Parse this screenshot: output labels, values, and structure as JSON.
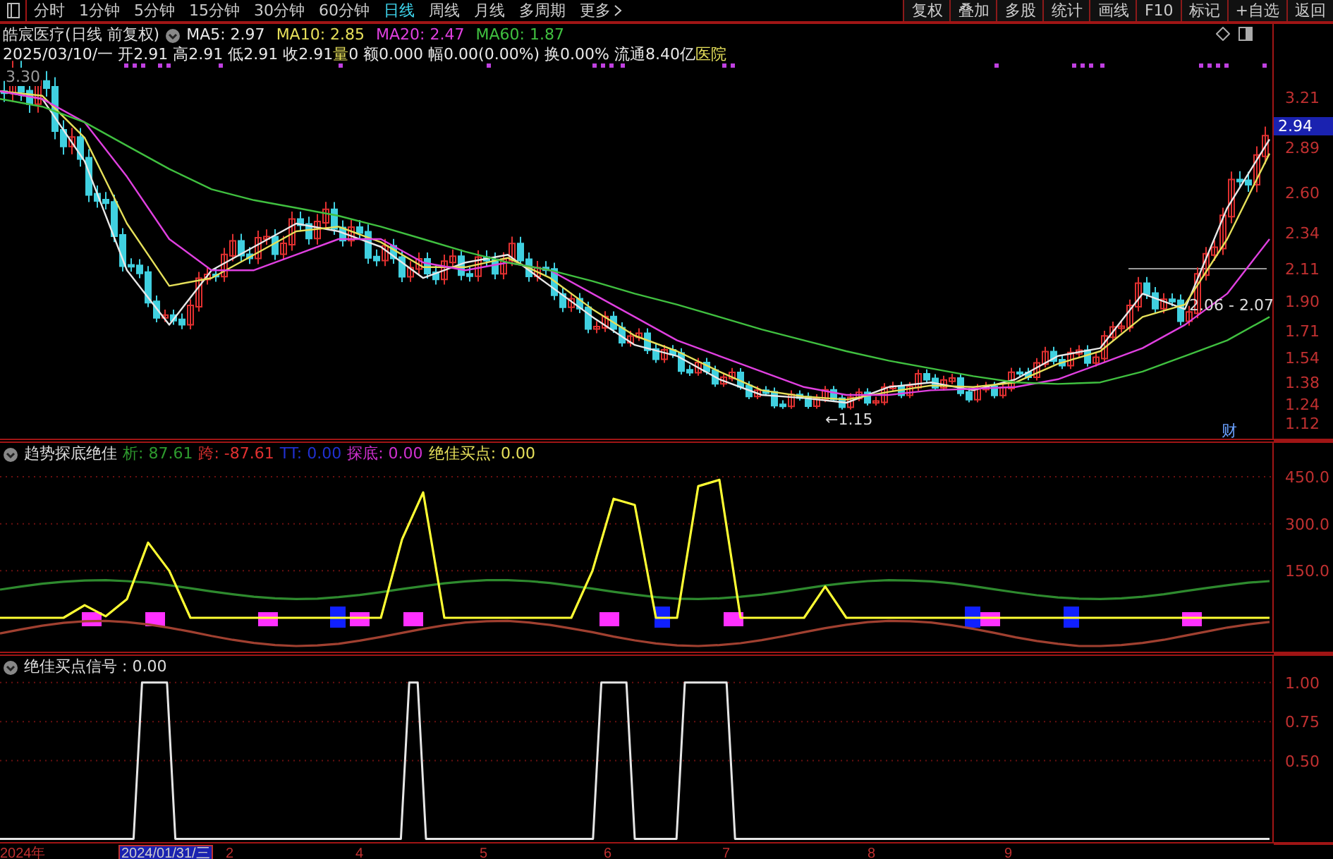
{
  "toolbar": {
    "periods": [
      {
        "label": "分时",
        "selected": false
      },
      {
        "label": "1分钟",
        "selected": false
      },
      {
        "label": "5分钟",
        "selected": false
      },
      {
        "label": "15分钟",
        "selected": false
      },
      {
        "label": "30分钟",
        "selected": false
      },
      {
        "label": "60分钟",
        "selected": false
      },
      {
        "label": "日线",
        "selected": true
      },
      {
        "label": "周线",
        "selected": false
      },
      {
        "label": "月线",
        "selected": false
      },
      {
        "label": "多周期",
        "selected": false
      },
      {
        "label": "更多",
        "selected": false
      }
    ],
    "actions": [
      "复权",
      "叠加",
      "多股",
      "统计",
      "画线",
      "F10",
      "标记",
      "+自选",
      "返回"
    ]
  },
  "price_panel": {
    "title": "皓宸医疗(日线 前复权)",
    "ma_readings": [
      ": 2.97",
      ": 2.85",
      ": 2.47",
      ": 1.87"
    ],
    "quote": [
      {
        "text": "2025/03/10/一 开2.91 高2.91 低2.91 收2.91",
        "color": "#e8e8e8"
      },
      {
        "text": "量",
        "color": "#e6e05a"
      },
      {
        "text": "0 额0.000 幅0.00(0.00%) 换0.00% 流通8.40亿",
        "color": "#e8e8e8"
      },
      {
        "text": "医院",
        "color": "#e6e05a"
      }
    ],
    "labels": [
      "3.30",
      "←1.15",
      "2.06 - 2.07",
      "财"
    ],
    "last_price": "2.94",
    "chart_data": {
      "type": "line",
      "ylim": [
        1.01,
        3.69
      ],
      "yticks": [
        {
          "value": 3.21,
          "label": "3.21"
        },
        {
          "value": 2.89,
          "label": "2.89"
        },
        {
          "value": 2.6,
          "label": "2.60"
        },
        {
          "value": 2.34,
          "label": "2.34"
        },
        {
          "value": 2.11,
          "label": "2.11"
        },
        {
          "value": 1.9,
          "label": "1.90"
        },
        {
          "value": 1.71,
          "label": "1.71"
        },
        {
          "value": 1.54,
          "label": "1.54"
        },
        {
          "value": 1.38,
          "label": "1.38"
        },
        {
          "value": 1.24,
          "label": "1.24"
        },
        {
          "value": 1.12,
          "label": "1.12"
        }
      ],
      "series": [
        {
          "name": "MA5",
          "color": "#e8e8e8",
          "values": [
            3.25,
            3.2,
            2.8,
            2.1,
            1.75,
            2.1,
            2.25,
            2.4,
            2.35,
            2.25,
            2.05,
            2.15,
            2.2,
            2.0,
            1.8,
            1.62,
            1.55,
            1.4,
            1.3,
            1.28,
            1.25,
            1.35,
            1.38,
            1.33,
            1.4,
            1.55,
            1.6,
            1.95,
            1.85,
            2.5,
            2.94
          ]
        },
        {
          "name": "MA10",
          "color": "#e6e05a",
          "values": [
            3.25,
            3.22,
            2.95,
            2.4,
            2.0,
            2.05,
            2.2,
            2.35,
            2.38,
            2.28,
            2.12,
            2.12,
            2.18,
            2.05,
            1.85,
            1.68,
            1.58,
            1.45,
            1.33,
            1.29,
            1.27,
            1.32,
            1.36,
            1.35,
            1.38,
            1.5,
            1.58,
            1.8,
            1.88,
            2.3,
            2.85
          ]
        },
        {
          "name": "MA20",
          "color": "#e040e0",
          "values": [
            3.25,
            3.2,
            3.05,
            2.7,
            2.3,
            2.1,
            2.1,
            2.2,
            2.3,
            2.3,
            2.15,
            2.1,
            2.15,
            2.1,
            1.95,
            1.8,
            1.65,
            1.55,
            1.45,
            1.35,
            1.3,
            1.3,
            1.33,
            1.34,
            1.35,
            1.4,
            1.5,
            1.6,
            1.75,
            1.95,
            2.3
          ]
        },
        {
          "name": "MA60",
          "color": "#40c040",
          "values": [
            3.2,
            3.15,
            3.05,
            2.9,
            2.75,
            2.62,
            2.55,
            2.5,
            2.45,
            2.38,
            2.3,
            2.22,
            2.15,
            2.1,
            2.03,
            1.95,
            1.88,
            1.8,
            1.72,
            1.65,
            1.58,
            1.52,
            1.47,
            1.42,
            1.38,
            1.37,
            1.38,
            1.45,
            1.55,
            1.65,
            1.8
          ]
        }
      ]
    }
  },
  "indicator_panel": {
    "title": "趋势探底绝佳",
    "readings": [
      {
        "text": "析: 87.61",
        "color": "#2e9a2e"
      },
      {
        "text": "跨: -87.61",
        "color": "#e03030"
      },
      {
        "text": "TT: 0.00",
        "color": "#2030d0"
      },
      {
        "text": "探底: 0.00",
        "color": "#d030d0"
      },
      {
        "text": "绝佳买点: 0.00",
        "color": "#e6e05a"
      }
    ],
    "chart_data": {
      "type": "line",
      "ylim": [
        -112.5,
        562.5
      ],
      "grid": true,
      "yticks": [
        {
          "value": 450,
          "label": "450.0"
        },
        {
          "value": 300,
          "label": "300.0"
        },
        {
          "value": 150,
          "label": "150.0"
        }
      ],
      "series": [
        {
          "color": "#2e8a2e",
          "values": [
            90,
            100,
            109,
            115,
            119,
            120,
            117,
            112,
            104,
            94,
            84,
            75,
            67,
            62,
            60,
            61,
            66,
            73,
            82,
            92,
            101,
            110,
            116,
            120,
            120,
            117,
            111,
            102,
            93,
            83,
            74,
            66,
            61,
            60,
            62,
            67,
            74,
            83,
            93,
            103,
            111,
            117,
            120,
            119,
            116,
            110,
            101,
            91,
            81,
            72,
            65,
            61,
            60,
            62,
            67,
            75,
            85,
            95,
            104,
            112,
            117
          ]
        },
        {
          "color": "#a04030",
          "values": [
            -50,
            -37,
            -25,
            -16,
            -11,
            -10,
            -14,
            -21,
            -32,
            -44,
            -58,
            -70,
            -80,
            -87,
            -90,
            -88,
            -83,
            -73,
            -61,
            -48,
            -35,
            -24,
            -15,
            -11,
            -10,
            -15,
            -23,
            -34,
            -46,
            -60,
            -72,
            -82,
            -88,
            -90,
            -87,
            -81,
            -71,
            -59,
            -46,
            -33,
            -22,
            -14,
            -10,
            -11,
            -15,
            -24,
            -35,
            -48,
            -62,
            -74,
            -83,
            -90,
            -90,
            -87,
            -80,
            -70,
            -57,
            -44,
            -31,
            -21,
            -13
          ]
        },
        {
          "color": "#ffff33",
          "values": [
            0,
            0,
            0,
            0,
            40,
            5,
            60,
            240,
            150,
            0,
            0,
            0,
            0,
            0,
            0,
            0,
            0,
            0,
            0,
            250,
            400,
            0,
            0,
            0,
            0,
            0,
            0,
            0,
            150,
            380,
            360,
            0,
            0,
            420,
            440,
            0,
            0,
            0,
            0,
            100,
            0,
            0,
            0,
            0,
            0,
            0,
            0,
            0,
            0,
            0,
            0,
            0,
            0,
            0,
            0,
            0,
            0,
            0,
            0,
            0,
            0
          ]
        }
      ]
    }
  },
  "signal_panel": {
    "title": "绝佳买点信号 : 0.00",
    "chart_data": {
      "type": "line",
      "ylim": [
        -0.03,
        1.18
      ],
      "grid": true,
      "yticks": [
        {
          "value": 1,
          "label": "1.00"
        },
        {
          "value": 0.75,
          "label": "0.75"
        },
        {
          "value": 0.5,
          "label": "0.50"
        }
      ],
      "series": [
        {
          "color": "#e6e6e6",
          "values": [
            0,
            0,
            0,
            0,
            0,
            0,
            0,
            0,
            0,
            0,
            0,
            0,
            0,
            0,
            0,
            0,
            0,
            1,
            1,
            1,
            1,
            0,
            0,
            0,
            0,
            0,
            0,
            0,
            0,
            0,
            0,
            0,
            0,
            0,
            0,
            0,
            0,
            0,
            0,
            0,
            0,
            0,
            0,
            0,
            0,
            0,
            0,
            0,
            0,
            1,
            1,
            0,
            0,
            0,
            0,
            0,
            0,
            0,
            0,
            0,
            0,
            0,
            0,
            0,
            0,
            0,
            0,
            0,
            0,
            0,
            0,
            0,
            1,
            1,
            1,
            1,
            0,
            0,
            0,
            0,
            0,
            0,
            1,
            1,
            1,
            1,
            1,
            1,
            0,
            0,
            0,
            0,
            0,
            0,
            0,
            0,
            0,
            0,
            0,
            0,
            0,
            0,
            0,
            0,
            0,
            0,
            0,
            0,
            0,
            0,
            0,
            0,
            0,
            0,
            0,
            0,
            0,
            0,
            0,
            0,
            0,
            0,
            0,
            0,
            0,
            0,
            0,
            0,
            0,
            0,
            0,
            0,
            0,
            0,
            0,
            0,
            0,
            0,
            0,
            0,
            0,
            0,
            0,
            0,
            0,
            0,
            0,
            0,
            0,
            0,
            0,
            0,
            0
          ]
        }
      ]
    }
  },
  "date_axis": [
    {
      "label": "2024年",
      "selected": false
    },
    {
      "label": "2024/01/31/三",
      "selected": true
    },
    {
      "label": "2",
      "selected": false
    },
    {
      "label": "4",
      "selected": false
    },
    {
      "label": "5",
      "selected": false
    },
    {
      "label": "6",
      "selected": false
    },
    {
      "label": "7",
      "selected": false
    },
    {
      "label": "8",
      "selected": false
    },
    {
      "label": "9",
      "selected": false
    }
  ]
}
